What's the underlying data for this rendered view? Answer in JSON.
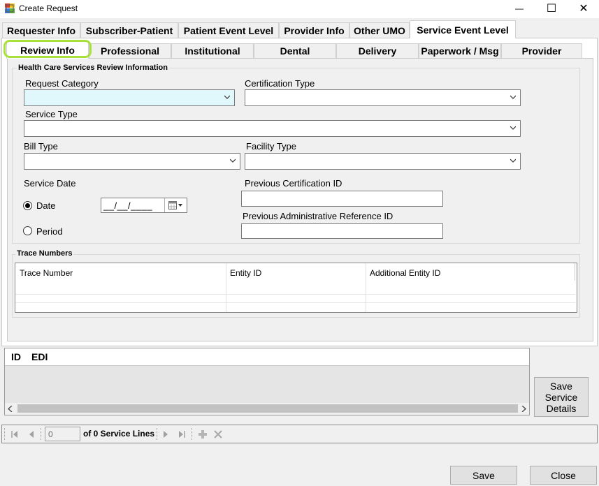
{
  "window": {
    "title": "Create Request",
    "minimize_glyph": "—",
    "maximize_glyph": "☐",
    "close_glyph": "✕"
  },
  "outer_tabs": [
    {
      "label": "Requester Info"
    },
    {
      "label": "Subscriber-Patient"
    },
    {
      "label": "Patient Event Level"
    },
    {
      "label": "Provider Info"
    },
    {
      "label": "Other UMO"
    },
    {
      "label": "Service Event Level",
      "active": true
    }
  ],
  "inner_tabs": [
    {
      "label": "Review Info",
      "active": true
    },
    {
      "label": "Professional"
    },
    {
      "label": "Institutional"
    },
    {
      "label": "Dental"
    },
    {
      "label": "Delivery"
    },
    {
      "label": "Paperwork / Msg"
    },
    {
      "label": "Provider"
    }
  ],
  "review": {
    "group_title": "Health Care Services Review Information",
    "request_category": {
      "label": "Request Category",
      "value": ""
    },
    "certification_type": {
      "label": "Certification Type",
      "value": ""
    },
    "service_type": {
      "label": "Service Type",
      "value": ""
    },
    "bill_type": {
      "label": "Bill Type",
      "value": ""
    },
    "facility_type": {
      "label": "Facility Type",
      "value": ""
    },
    "service_date": {
      "label": "Service Date",
      "date_option": {
        "label": "Date",
        "selected": true
      },
      "period_option": {
        "label": "Period",
        "selected": false
      },
      "date_value": "__/__/____"
    },
    "previous_certification_id": {
      "label": "Previous Certification ID",
      "value": ""
    },
    "previous_admin_ref_id": {
      "label": "Previous Administrative Reference ID",
      "value": ""
    }
  },
  "trace_numbers": {
    "group_title": "Trace Numbers",
    "columns": [
      "Trace Number",
      "Entity ID",
      "Additional Entity ID"
    ]
  },
  "service_lines_grid": {
    "columns": [
      "ID",
      "EDI"
    ]
  },
  "buttons": {
    "save_service_details": "Save Service Details",
    "save": "Save",
    "close": "Close"
  },
  "navigator": {
    "position": "0",
    "count_text": "of 0 Service Lines"
  },
  "colors": {
    "required_field": "#e0f8fc",
    "highlight": "#a8e03c",
    "panel": "#f0f0f0"
  },
  "icons": [
    "app-icon",
    "calendar-icon",
    "chevron-down-icon",
    "move-first-icon",
    "move-previous-icon",
    "move-next-icon",
    "move-last-icon",
    "add-icon",
    "delete-icon"
  ]
}
